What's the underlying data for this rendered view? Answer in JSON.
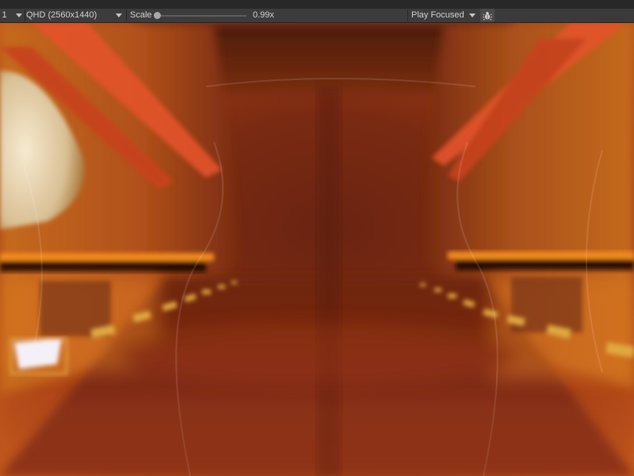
{
  "toolbar": {
    "display": "y 1",
    "resolution": "QHD (2560x1440)",
    "scale_label": "Scale",
    "scale_value": "0.99x",
    "scale_fraction": 0.0,
    "play_mode": "Play Focused"
  },
  "icons": {
    "bug": "bug-icon"
  },
  "colors": {
    "toolbar_bg": "#3c3c3c",
    "text": "#d2d2d2",
    "accent_orange": "#d9621e",
    "floor_stripe_yellow": "#e0a840"
  }
}
